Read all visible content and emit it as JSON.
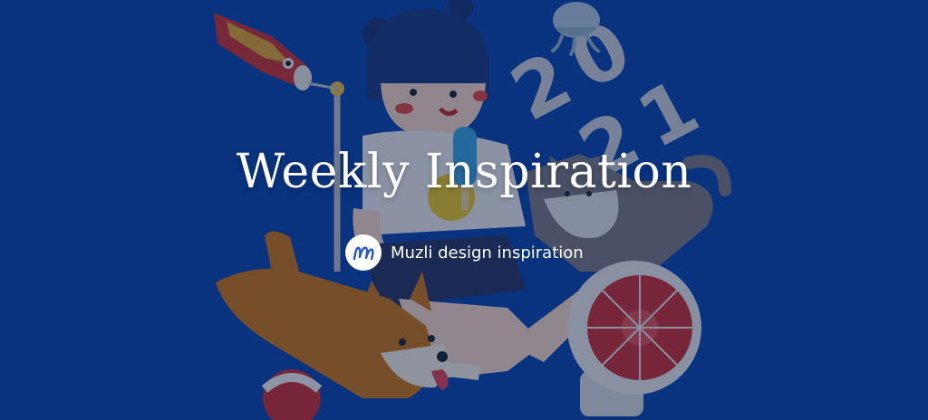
{
  "hero": {
    "title": "Weekly Inspiration",
    "brand": {
      "name": "Muzli design inspiration",
      "logo_icon": "muzli-m-logo-icon",
      "logo_letter": "m"
    },
    "artwork": {
      "year_digits": [
        "2",
        "0",
        "2",
        "1"
      ],
      "icons": [
        "koi-windsock-icon",
        "jellyfish-icon",
        "girl-with-popsicle-illustration",
        "shiba-dog-illustration",
        "cat-illustration",
        "electric-fan-icon",
        "ball-icon"
      ]
    },
    "colors": {
      "background": "#0c47b0",
      "overlay": "#08163c",
      "text": "#ffffff",
      "fan_red": "#c8323a",
      "dog_orange": "#c8781e"
    }
  }
}
